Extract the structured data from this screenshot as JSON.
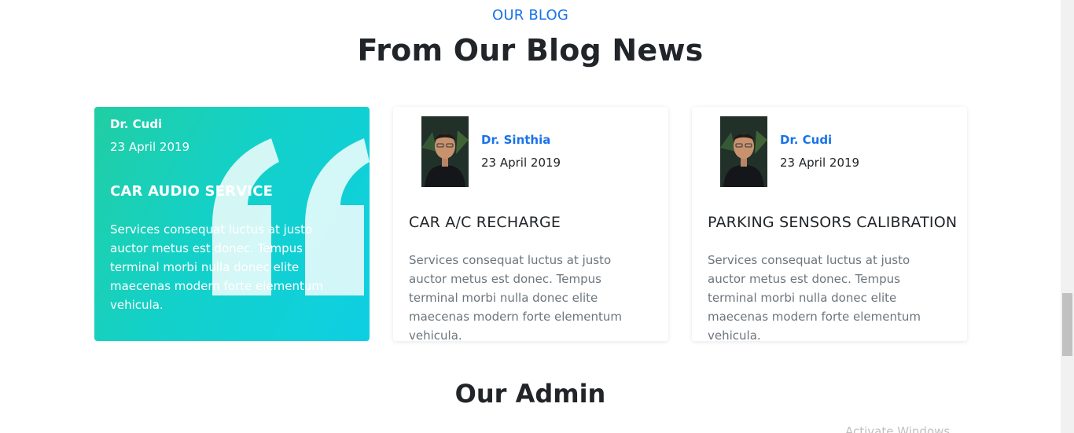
{
  "header": {
    "eyebrow": "OUR BLOG",
    "title": "From Our Blog News"
  },
  "posts": [
    {
      "author": "Dr. Cudi",
      "date": "23 April 2019",
      "title": "CAR AUDIO SERVICE",
      "text": "Services consequat luctus at justo auctor metus est donec. Tempus terminal morbi nulla donec elite maecenas modern forte elementum vehicula.",
      "style": "featured"
    },
    {
      "author": "Dr. Sinthia",
      "date": "23 April 2019",
      "title": "CAR A/C RECHARGE",
      "text": "Services consequat luctus at justo auctor metus est donec. Tempus terminal morbi nulla donec elite maecenas modern forte elementum vehicula.",
      "style": "plain"
    },
    {
      "author": "Dr. Cudi",
      "date": "23 April 2019",
      "title": "PARKING SENSORS CALIBRATION",
      "text": "Services consequat luctus at justo auctor metus est donec. Tempus terminal morbi nulla donec elite maecenas modern forte elementum vehicula.",
      "style": "plain"
    }
  ],
  "admin": {
    "title": "Our Admin"
  },
  "watermark": {
    "text": "Activate Windows"
  },
  "colors": {
    "accent": "#1a73e8",
    "gradient_start": "#21cea3",
    "gradient_end": "#0ecfe3",
    "body_text": "#212529",
    "muted_text": "#6c757d"
  },
  "icons": {
    "featured_decoration": "quote-icon",
    "author_photo": "avatar"
  }
}
